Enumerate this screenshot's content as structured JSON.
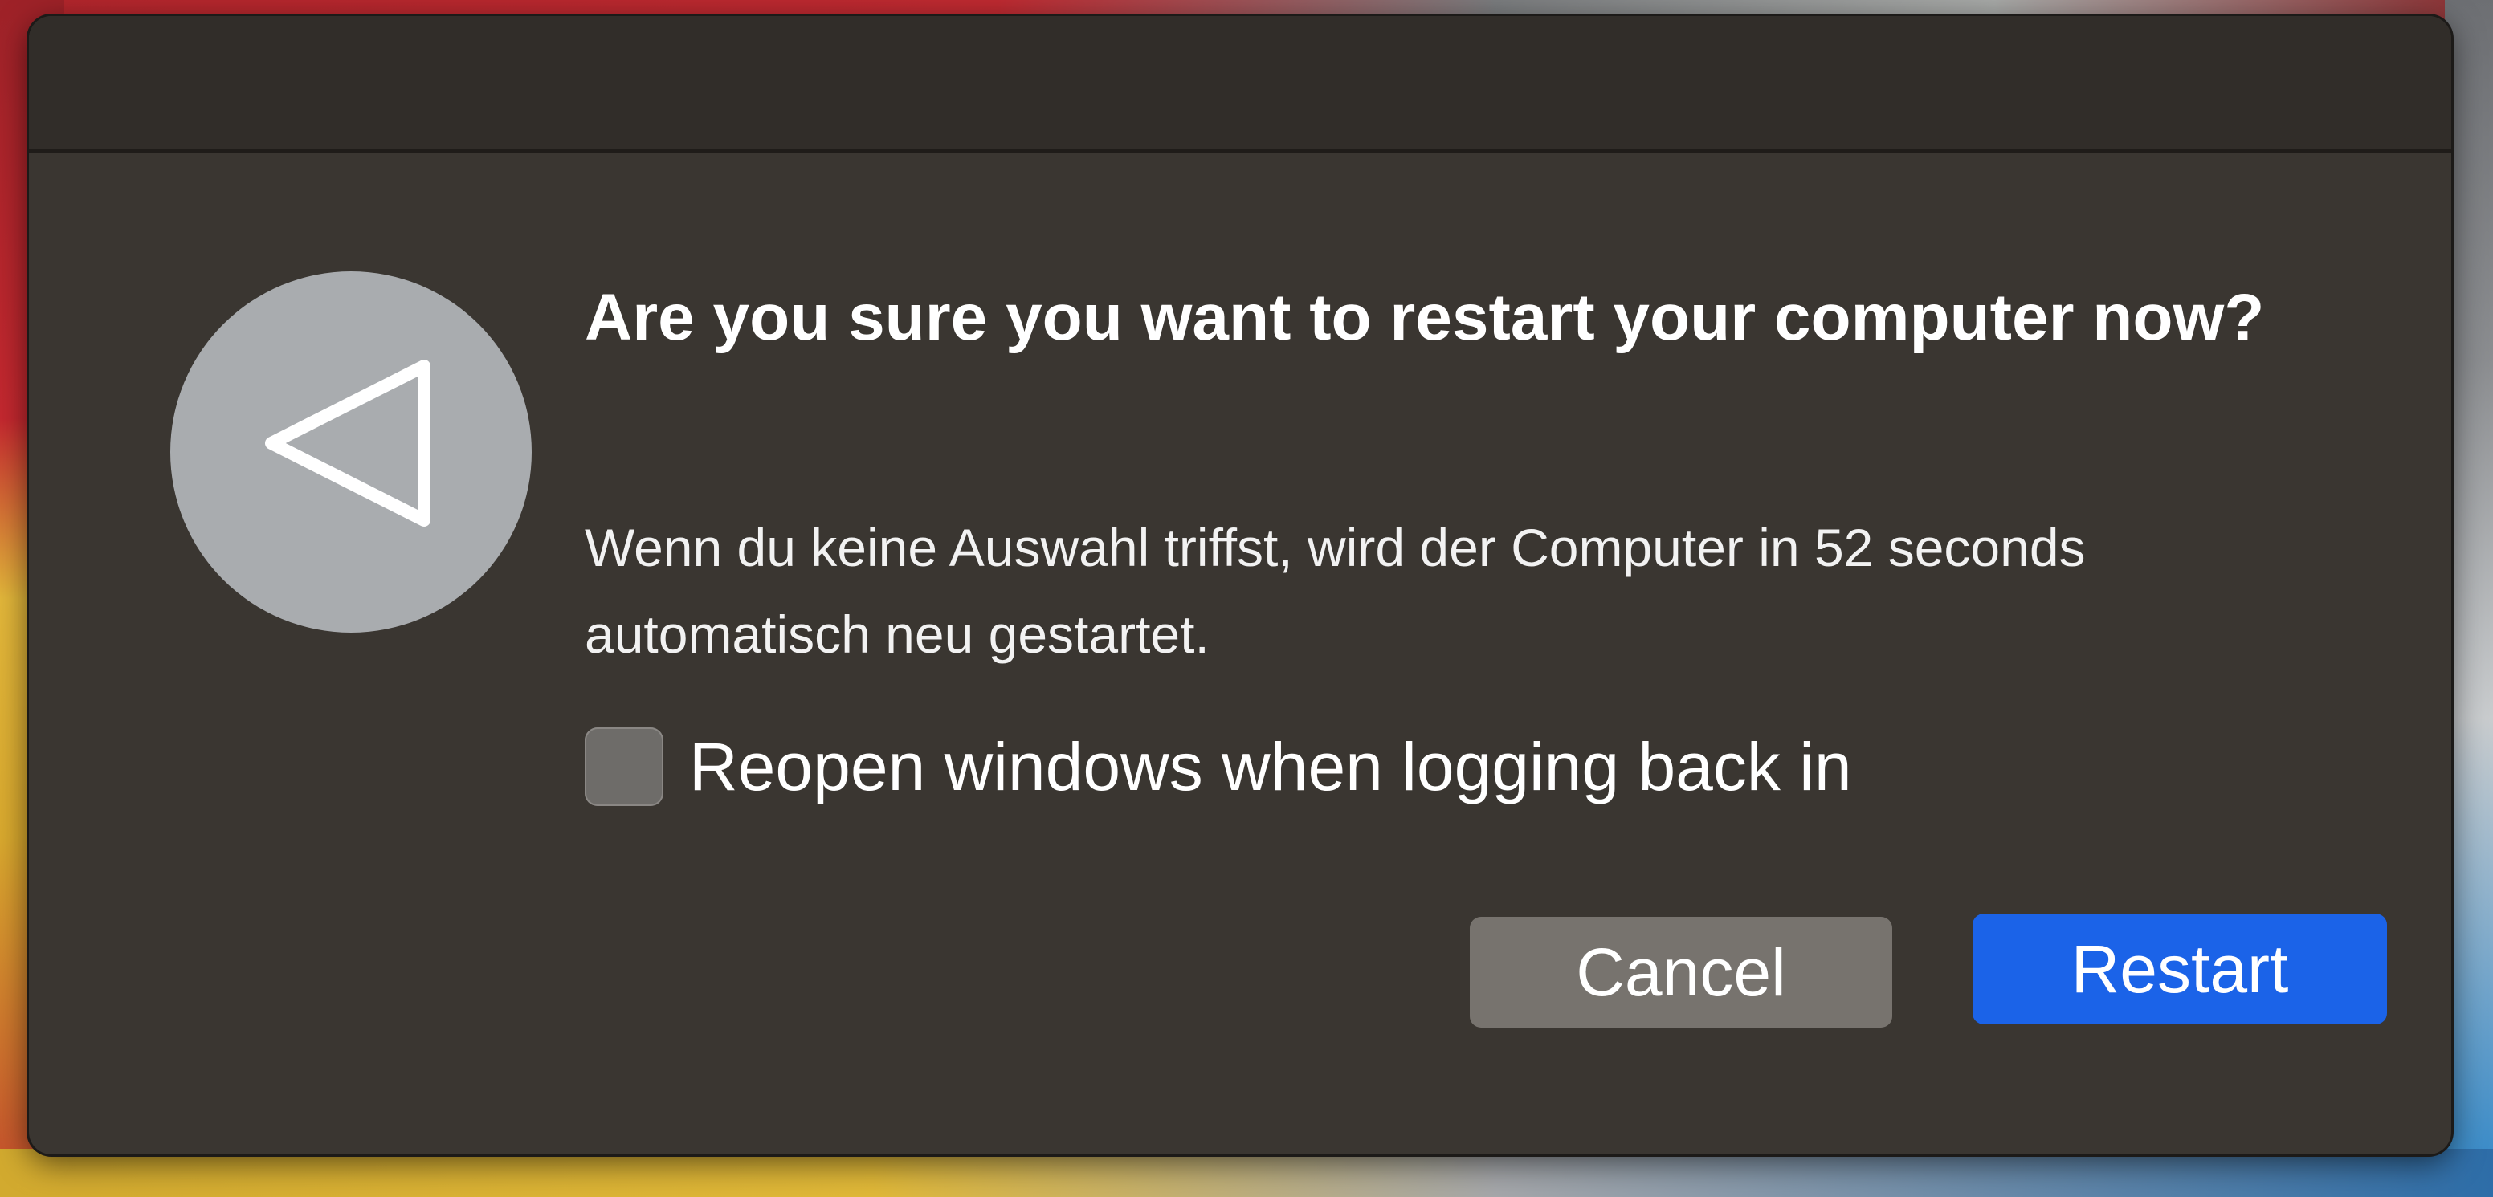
{
  "dialog": {
    "title": "Are you sure you want to restart your computer now?",
    "message": "Wenn du keine Auswahl triffst, wird der Computer in 52 seconds automatisch neu gestartet.",
    "countdown_seconds": 52,
    "icon": "restart-icon",
    "checkbox": {
      "label": "Reopen windows when logging back in",
      "checked": false
    },
    "buttons": {
      "cancel_label": "Cancel",
      "restart_label": "Restart"
    }
  },
  "colors": {
    "dialog_background": "#3a3631",
    "primary_button": "#1b63e8",
    "secondary_button": "#77736e",
    "icon_circle": "#a9acaf"
  }
}
